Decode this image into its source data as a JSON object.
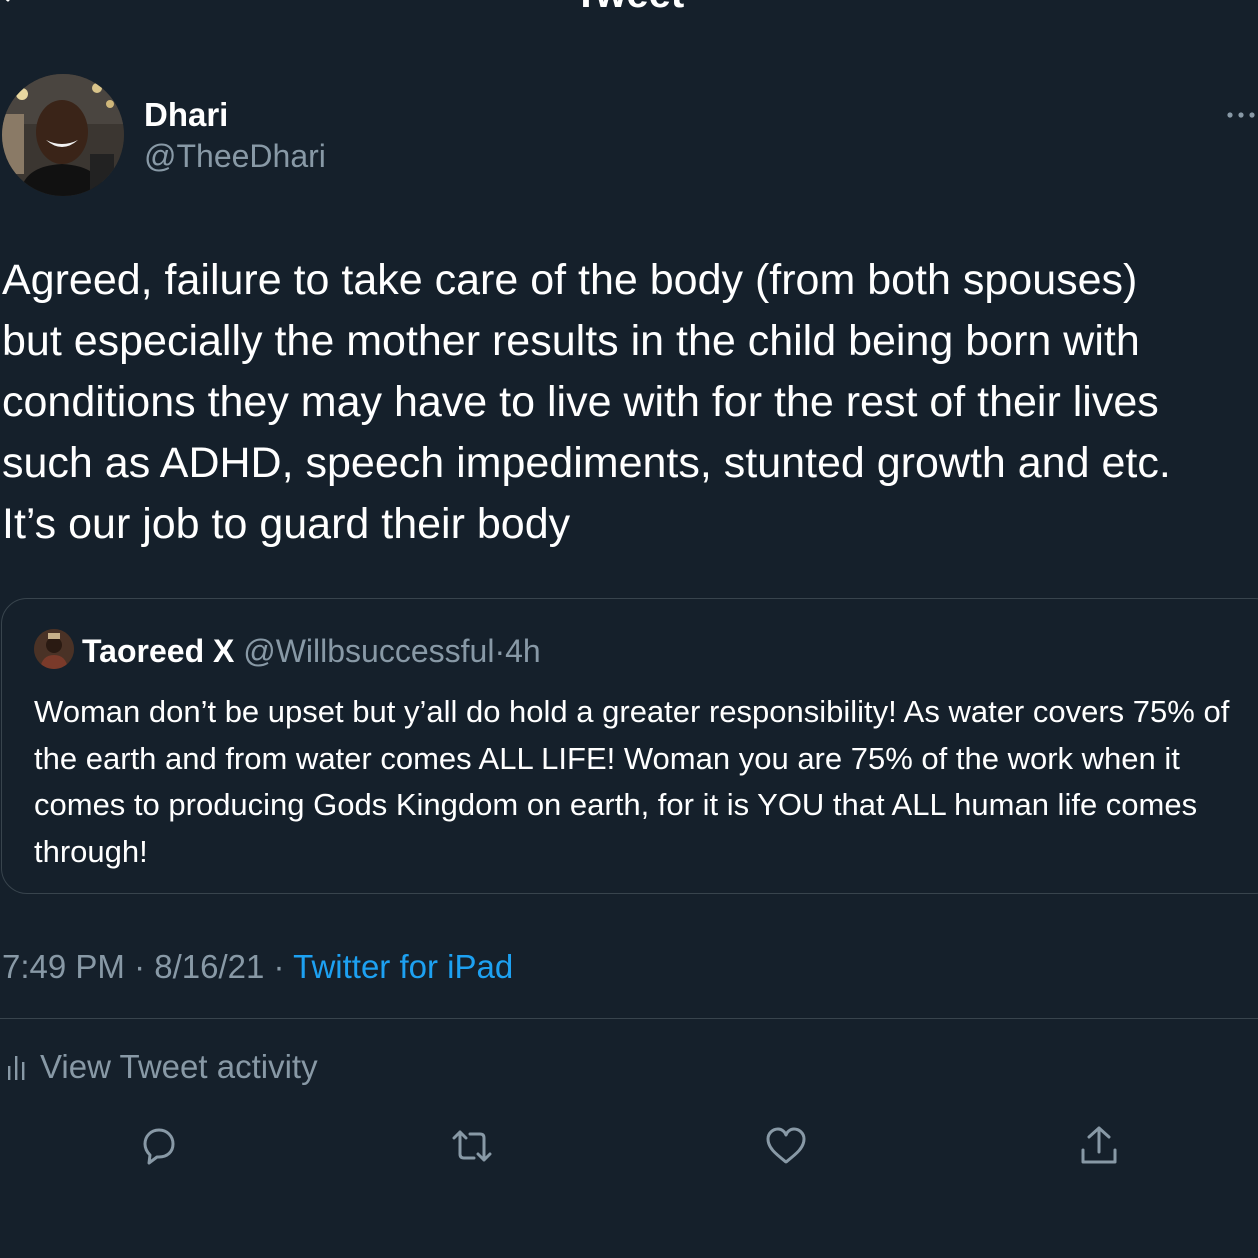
{
  "header": {
    "title": "Tweet"
  },
  "tweet": {
    "author_name": "Dhari",
    "author_handle": "@TheeDhari",
    "text": "Agreed, failure to take care of the body (from both spouses)\nbut especially the mother results in the child being born with\nconditions they may have to live with for the rest of their lives\nsuch as ADHD, speech impediments, stunted growth and etc.\nIt’s our job to guard their body",
    "time": "7:49 PM",
    "separator": "·",
    "date": "8/16/21",
    "source": "Twitter for iPad"
  },
  "quote": {
    "author_name": "Taoreed X",
    "author_handle": "@Willbsuccessful",
    "separator": "·",
    "time": "4h",
    "text": "Woman don’t be upset but y’all do hold a greater responsibility! As water covers 75% of the earth and from water comes ALL LIFE! Woman you are 75% of the work when it comes to producing Gods Kingdom on earth, for it is YOU that ALL human life comes through!"
  },
  "activity": {
    "label": "View Tweet activity"
  },
  "actions": {
    "icons": [
      "reply-icon",
      "retweet-icon",
      "like-icon",
      "share-icon"
    ]
  },
  "colors": {
    "background": "#15202b",
    "secondary_text": "#8899a6",
    "accent": "#1da1f2",
    "border": "#38444d"
  }
}
